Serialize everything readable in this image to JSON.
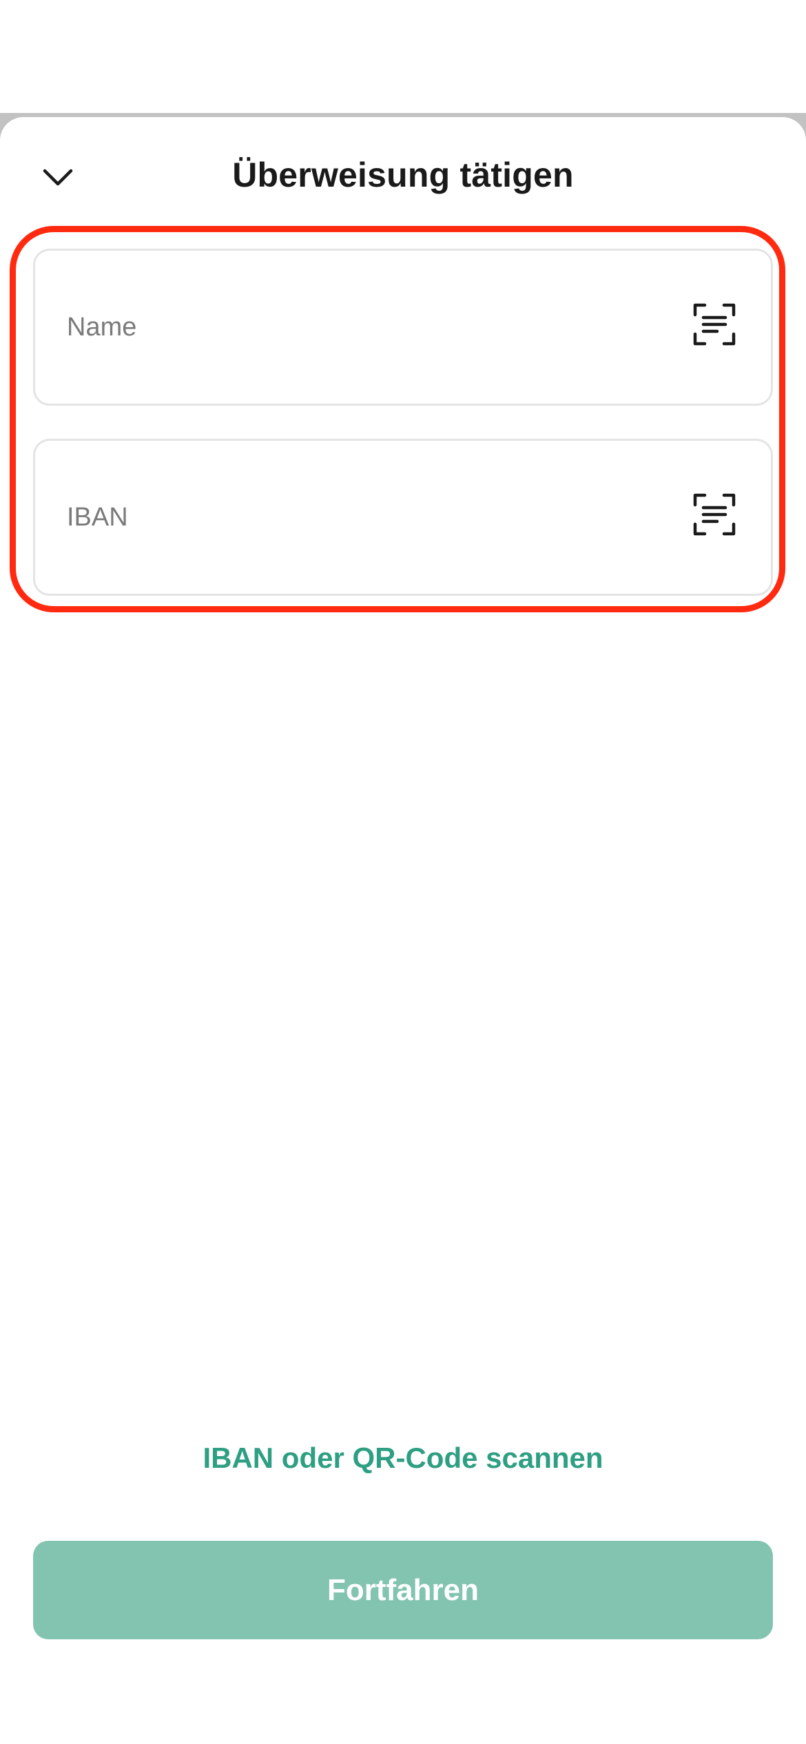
{
  "header": {
    "title": "Überweisung tätigen",
    "back_icon": "chevron-down-icon"
  },
  "form": {
    "name_field": {
      "placeholder": "Name",
      "value": "",
      "icon": "text-scan-icon"
    },
    "iban_field": {
      "placeholder": "IBAN",
      "value": "",
      "icon": "text-scan-icon"
    }
  },
  "actions": {
    "scan_link_label": "IBAN oder QR-Code scannen",
    "continue_label": "Fortfahren"
  },
  "colors": {
    "accent": "#2e9f82",
    "button_disabled": "#83c4b0",
    "highlight": "#ff2a10"
  }
}
